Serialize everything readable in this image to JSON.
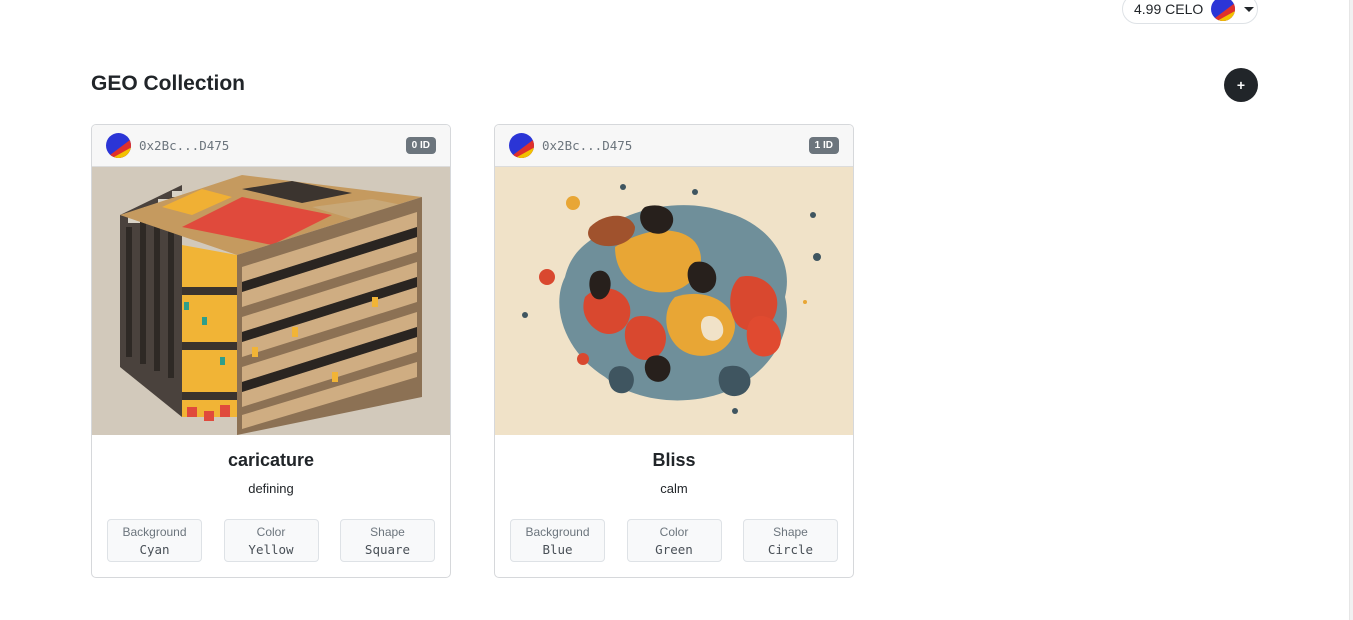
{
  "wallet": {
    "balance": "4.99 CELO"
  },
  "collection": {
    "title": "GEO Collection",
    "add_label": "+"
  },
  "nfts": [
    {
      "owner": "0x2Bc...D475",
      "badge": "0 ID",
      "name": "caricature",
      "description": "defining",
      "attributes": [
        {
          "trait": "Background",
          "value": "Cyan"
        },
        {
          "trait": "Color",
          "value": "Yellow"
        },
        {
          "trait": "Shape",
          "value": "Square"
        }
      ]
    },
    {
      "owner": "0x2Bc...D475",
      "badge": "1 ID",
      "name": "Bliss",
      "description": "calm",
      "attributes": [
        {
          "trait": "Background",
          "value": "Blue"
        },
        {
          "trait": "Color",
          "value": "Green"
        },
        {
          "trait": "Shape",
          "value": "Circle"
        }
      ]
    }
  ],
  "colors": {
    "avatar_blue": "#2b35d6",
    "avatar_red": "#e0302b",
    "avatar_yellow": "#f2c200",
    "badge": "#6c757d",
    "add_button": "#212529"
  }
}
